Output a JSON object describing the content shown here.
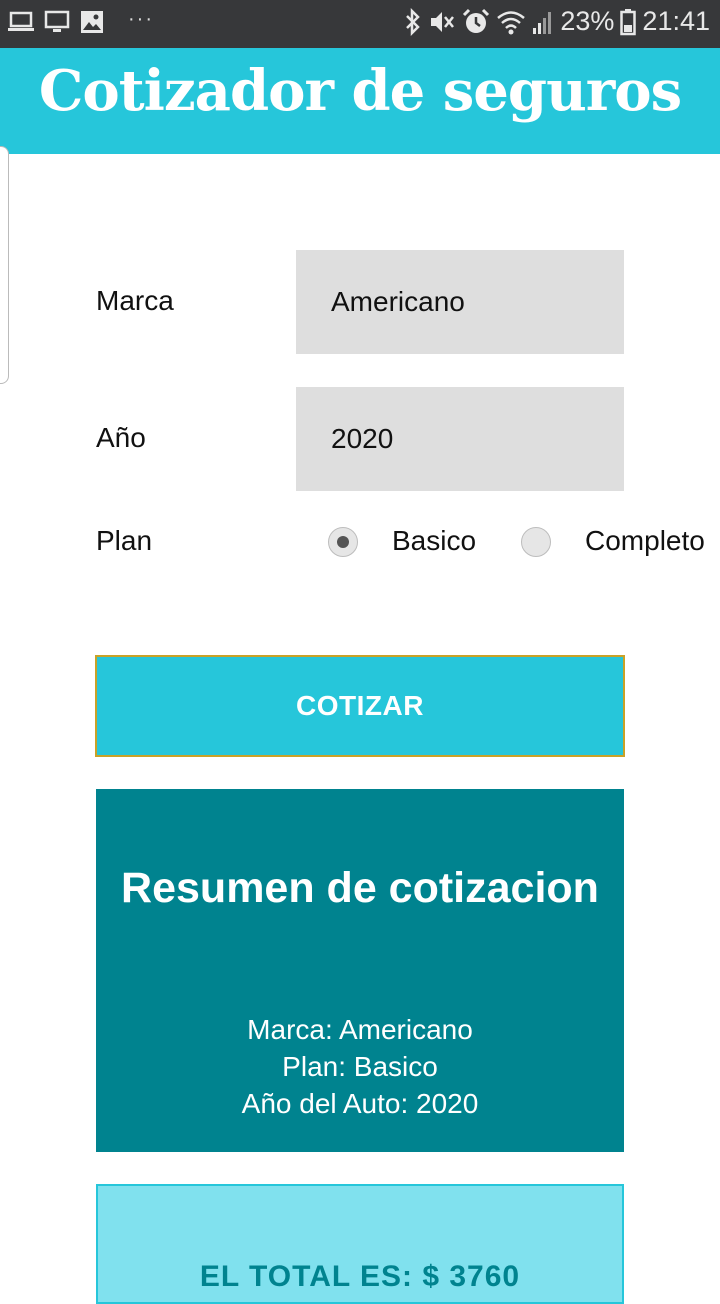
{
  "status_bar": {
    "battery": "23%",
    "time": "21:41",
    "dots": "···",
    "left_icons": [
      "laptop-icon",
      "monitor-icon",
      "image-icon"
    ],
    "right_icons": [
      "bluetooth-icon",
      "mute-icon",
      "alarm-icon",
      "wifi-icon",
      "signal-icon",
      "battery-icon"
    ]
  },
  "header": {
    "title": "Cotizador de seguros"
  },
  "form": {
    "marca_label": "Marca",
    "marca_value": "Americano",
    "anio_label": "Año",
    "anio_value": "2020",
    "plan_label": "Plan",
    "plan_options": [
      {
        "label": "Basico",
        "selected": true
      },
      {
        "label": "Completo",
        "selected": false
      }
    ],
    "submit_label": "COTIZAR"
  },
  "resumen": {
    "title": "Resumen de cotizacion",
    "marca": "Marca: Americano",
    "plan": "Plan: Basico",
    "anio": "Año del Auto: 2020"
  },
  "total": {
    "text": "EL TOTAL ES: $ 3760"
  },
  "colors": {
    "primary": "#26c6da",
    "dark_teal": "#00838f",
    "light_teal": "#80e1ee",
    "field_bg": "#dedede",
    "status_bar": "#37383a"
  }
}
